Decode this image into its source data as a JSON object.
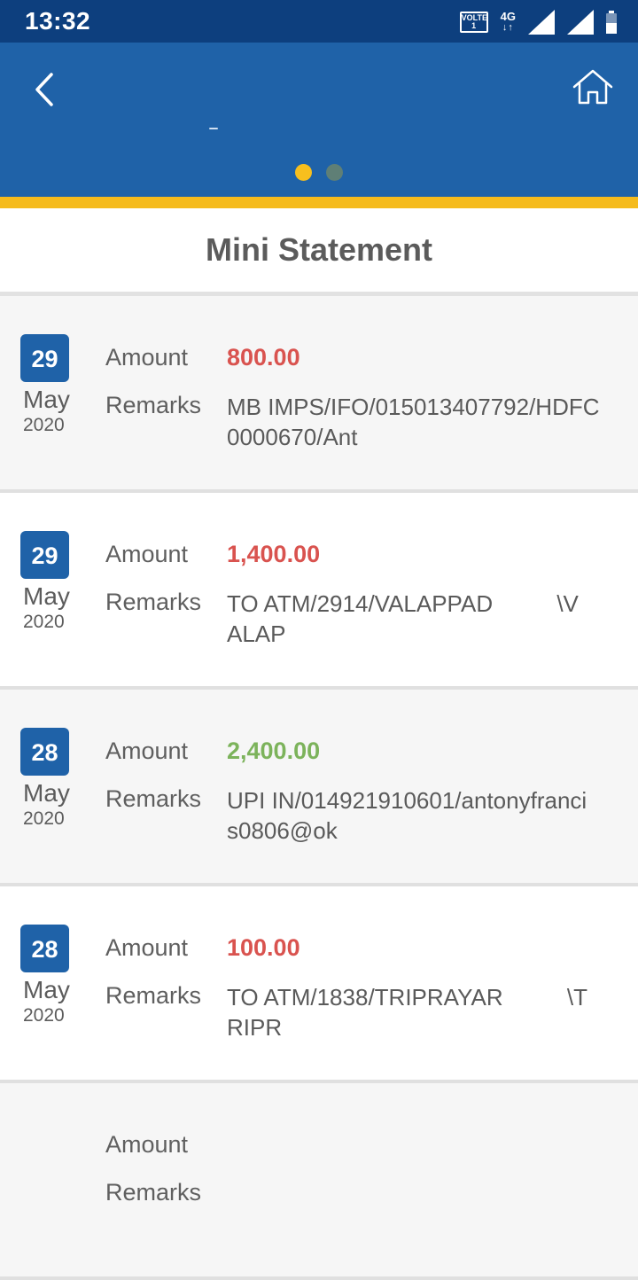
{
  "status_bar": {
    "time": "13:32",
    "volte_top": "VOLTE",
    "volte_bottom": "1",
    "network": "4G",
    "network_arrows": "↓↑"
  },
  "header": {
    "back_icon": "chevron-left-icon",
    "home_icon": "home-icon",
    "carousel_pages": 2,
    "carousel_active": 1
  },
  "page_title": "Mini Statement",
  "labels": {
    "amount": "Amount",
    "remarks": "Remarks"
  },
  "colors": {
    "header": "#1f62a8",
    "status_bar": "#0d3f7e",
    "accent": "#f5bb1d",
    "debit": "#d9534f",
    "credit": "#7cb35b"
  },
  "transactions": [
    {
      "day": "29",
      "month": "May",
      "year": "2020",
      "amount": "800.00",
      "type": "debit",
      "remarks_lines": [
        "MB IMPS/IFO/015013407792/HDFC",
        "0000670/Ant"
      ]
    },
    {
      "day": "29",
      "month": "May",
      "year": "2020",
      "amount": "1,400.00",
      "type": "debit",
      "remarks_lines": [
        "TO ATM/2914/VALAPPAD          \\V",
        "ALAP"
      ]
    },
    {
      "day": "28",
      "month": "May",
      "year": "2020",
      "amount": "2,400.00",
      "type": "credit",
      "remarks_lines": [
        "UPI IN/014921910601/antonyfranci",
        "s0806@ok"
      ]
    },
    {
      "day": "28",
      "month": "May",
      "year": "2020",
      "amount": "100.00",
      "type": "debit",
      "remarks_lines": [
        "TO ATM/1838/TRIPRAYAR          \\T",
        "RIPR"
      ]
    },
    {
      "day": "",
      "month": "",
      "year": "",
      "amount": "",
      "type": "debit",
      "remarks_lines": []
    }
  ]
}
